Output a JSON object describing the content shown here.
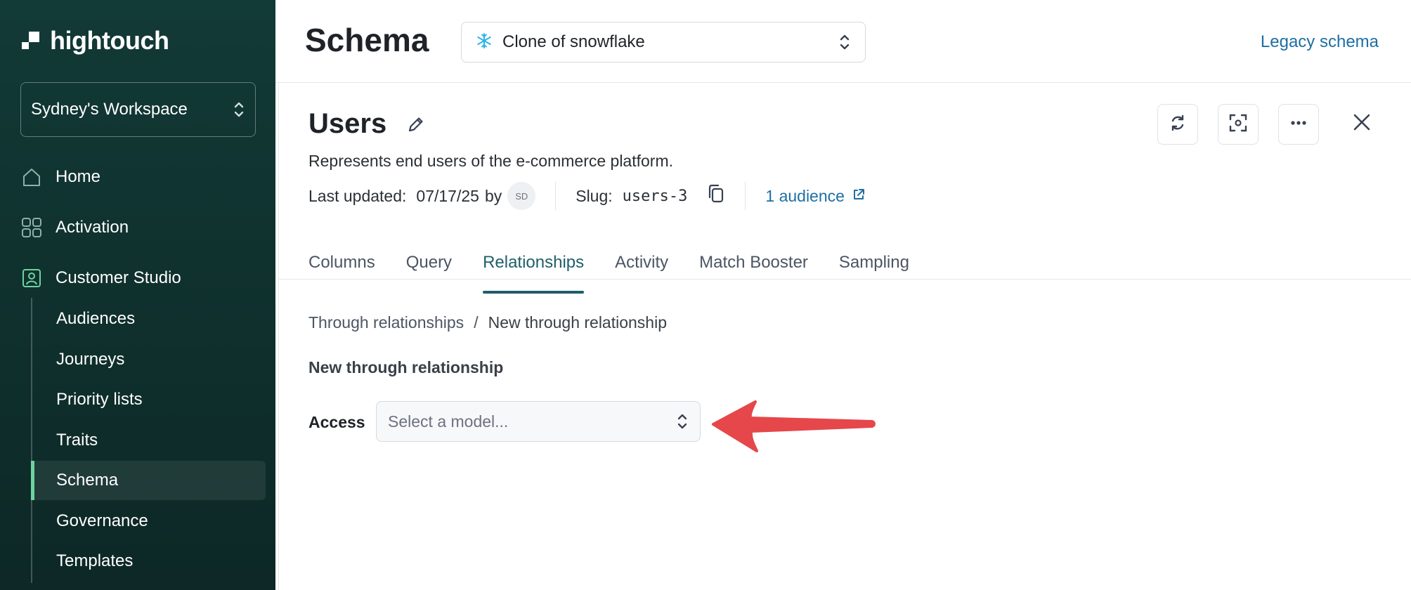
{
  "sidebar": {
    "brand": "hightouch",
    "workspace": "Sydney's Workspace",
    "nav": [
      {
        "label": "Home",
        "icon": "home-icon"
      },
      {
        "label": "Activation",
        "icon": "activation-icon"
      },
      {
        "label": "Customer Studio",
        "icon": "customer-studio-icon"
      }
    ],
    "sub_items": [
      "Audiences",
      "Journeys",
      "Priority lists",
      "Traits",
      "Schema",
      "Governance",
      "Templates"
    ],
    "active_sub_item": "Schema",
    "accent": "#6dd3a0"
  },
  "header": {
    "title": "Schema",
    "source_select": {
      "value": "Clone of snowflake",
      "icon": "snowflake-icon"
    },
    "legacy_link": "Legacy schema"
  },
  "model": {
    "title": "Users",
    "description": "Represents end users of the e-commerce platform.",
    "last_updated_label": "Last updated:",
    "last_updated_value": "07/17/25",
    "by": "by",
    "avatar_initials": "SD",
    "slug_label": "Slug:",
    "slug_value": "users-3",
    "audience_link": "1 audience"
  },
  "tabs": [
    "Columns",
    "Query",
    "Relationships",
    "Activity",
    "Match Booster",
    "Sampling"
  ],
  "active_tab": "Relationships",
  "breadcrumb": {
    "parent": "Through relationships",
    "separator": "/",
    "current": "New through relationship"
  },
  "form": {
    "heading": "New through relationship",
    "access_label": "Access",
    "model_placeholder": "Select a model..."
  },
  "colors": {
    "sidebar_bg": "#123a36",
    "link": "#1d6fa3",
    "active_tab": "#1f5f69",
    "annotation_arrow": "#e5474b"
  }
}
